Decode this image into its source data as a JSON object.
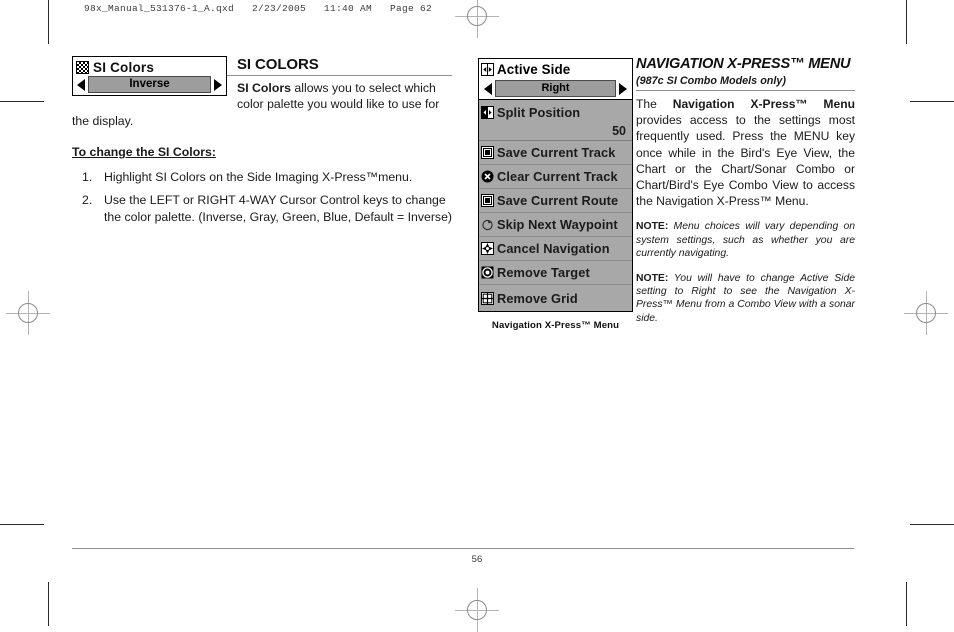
{
  "print_header": {
    "text": "98x_Manual_531376-1_A.qxd   2/23/2005   11:40 AM   Page 62"
  },
  "left_column": {
    "widget": {
      "icon": "dither-pattern-icon",
      "title": "SI Colors",
      "left_arrow": "left-arrow-icon",
      "right_arrow": "right-arrow-icon",
      "value": "Inverse"
    },
    "heading": "SI COLORS",
    "intro_bold": "SI Colors",
    "intro_rest": " allows you to select which color palette you would like to use for the display.",
    "subheading": "To change the SI Colors:",
    "steps": [
      {
        "num": "1.",
        "text": "Highlight SI Colors on the Side Imaging X-Press™menu."
      },
      {
        "num": "2.",
        "text": "Use the LEFT or RIGHT 4-WAY Cursor Control keys to change the color palette. (Inverse, Gray, Green, Blue, Default = Inverse)"
      }
    ]
  },
  "device_menu": {
    "header": {
      "icon": "active-side-icon",
      "label": "Active Side",
      "left_arrow": "left-arrow-icon",
      "right_arrow": "right-arrow-icon",
      "value": "Right"
    },
    "split": {
      "icon": "split-position-icon",
      "label": "Split Position",
      "value": "50"
    },
    "items": [
      {
        "icon": "save-track-icon",
        "label": "Save Current Track"
      },
      {
        "icon": "clear-track-icon",
        "label": "Clear Current Track"
      },
      {
        "icon": "save-route-icon",
        "label": "Save Current Route"
      },
      {
        "icon": "skip-waypoint-icon",
        "label": "Skip Next Waypoint"
      },
      {
        "icon": "cancel-navigation-icon",
        "label": "Cancel Navigation"
      },
      {
        "icon": "remove-target-icon",
        "label": "Remove Target"
      },
      {
        "icon": "remove-grid-icon",
        "label": "Remove Grid"
      }
    ],
    "caption": "Navigation X-Press™ Menu"
  },
  "right_column": {
    "heading": "NAVIGATION X-PRESS™ MENU",
    "subheading": "(987c SI Combo Models only)",
    "body_lead": "The ",
    "body_bold": "Navigation X-Press™ Menu",
    "body_rest": " provides access to the settings most frequently used. Press the MENU key once while in the Bird's Eye View, the Chart or the Chart/Sonar Combo or Chart/Bird's Eye Combo View to access the Navigation X-Press™ Menu.",
    "notes": [
      {
        "label": "NOTE:",
        "text": " Menu choices will vary depending on system settings, such as whether you are currently navigating."
      },
      {
        "label": "NOTE:",
        "text": " You will have to change Active Side setting to Right to see the Navigation X-Press™ Menu from a Combo View with a sonar side."
      }
    ]
  },
  "footer": {
    "page_number": "56"
  },
  "colors": {
    "menu_bg": "#a8a8a8",
    "value_bar": "#9d9d9d",
    "rule": "#8e8e8e"
  }
}
